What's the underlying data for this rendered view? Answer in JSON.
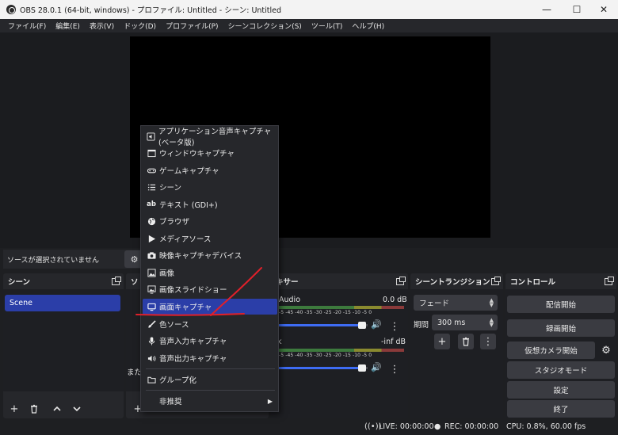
{
  "window": {
    "title": "OBS 28.0.1 (64-bit, windows) - プロファイル: Untitled - シーン: Untitled",
    "minimize": "—",
    "maximize": "☐",
    "close": "✕"
  },
  "menu": [
    "ファイル(F)",
    "編集(E)",
    "表示(V)",
    "ドック(D)",
    "プロファイル(P)",
    "シーンコレクション(S)",
    "ツール(T)",
    "ヘルプ(H)"
  ],
  "source_bar": {
    "text": "ソースが選択されていません"
  },
  "docks": {
    "scenes": {
      "title": "シーン",
      "items": [
        "Scene"
      ]
    },
    "sources": {
      "title_fragment": "ソ",
      "hint_fragment": "また"
    },
    "mixer": {
      "title_fragment": "キサー",
      "channels": [
        {
          "name": "Audio",
          "level": "0.0 dB",
          "volume_pct": 100
        },
        {
          "name": "k",
          "level": "-inf dB",
          "volume_pct": 100
        }
      ],
      "scale": "-5 -45 -40 -35 -30 -25 -20 -15 -10 -5 0"
    },
    "transitions": {
      "title": "シーントランジション",
      "type": "フェード",
      "duration_label": "期間",
      "duration": "300 ms"
    },
    "controls": {
      "title": "コントロール",
      "buttons": [
        "配信開始",
        "録画開始",
        "仮想カメラ開始",
        "スタジオモード",
        "設定",
        "終了"
      ]
    }
  },
  "context_menu": {
    "items": [
      {
        "label": "アプリケーション音声キャプチャ (ベータ版)",
        "icon": "app-audio-icon"
      },
      {
        "label": "ウィンドウキャプチャ",
        "icon": "window-icon"
      },
      {
        "label": "ゲームキャプチャ",
        "icon": "gamepad-icon"
      },
      {
        "label": "シーン",
        "icon": "list-icon"
      },
      {
        "label": "テキスト (GDI+)",
        "icon": "text-icon"
      },
      {
        "label": "ブラウザ",
        "icon": "globe-icon"
      },
      {
        "label": "メディアソース",
        "icon": "play-icon"
      },
      {
        "label": "映像キャプチャデバイス",
        "icon": "camera-icon"
      },
      {
        "label": "画像",
        "icon": "image-icon"
      },
      {
        "label": "画像スライドショー",
        "icon": "slideshow-icon"
      },
      {
        "label": "画面キャプチャ",
        "icon": "monitor-icon",
        "active": true
      },
      {
        "label": "色ソース",
        "icon": "brush-icon"
      },
      {
        "label": "音声入力キャプチャ",
        "icon": "microphone-icon"
      },
      {
        "label": "音声出力キャプチャ",
        "icon": "speaker-icon"
      },
      {
        "label": "グループ化",
        "icon": "folder-icon"
      },
      {
        "label": "非推奨",
        "icon": "",
        "submenu": true
      }
    ]
  },
  "status": {
    "live": "LIVE: 00:00:00",
    "rec": "REC: 00:00:00",
    "cpu": "CPU: 0.8%, 60.00 fps"
  },
  "colors": {
    "accent": "#2b3ea8",
    "annotation": "#e0202a",
    "background": "#1e1f22",
    "panel": "#26272b"
  }
}
